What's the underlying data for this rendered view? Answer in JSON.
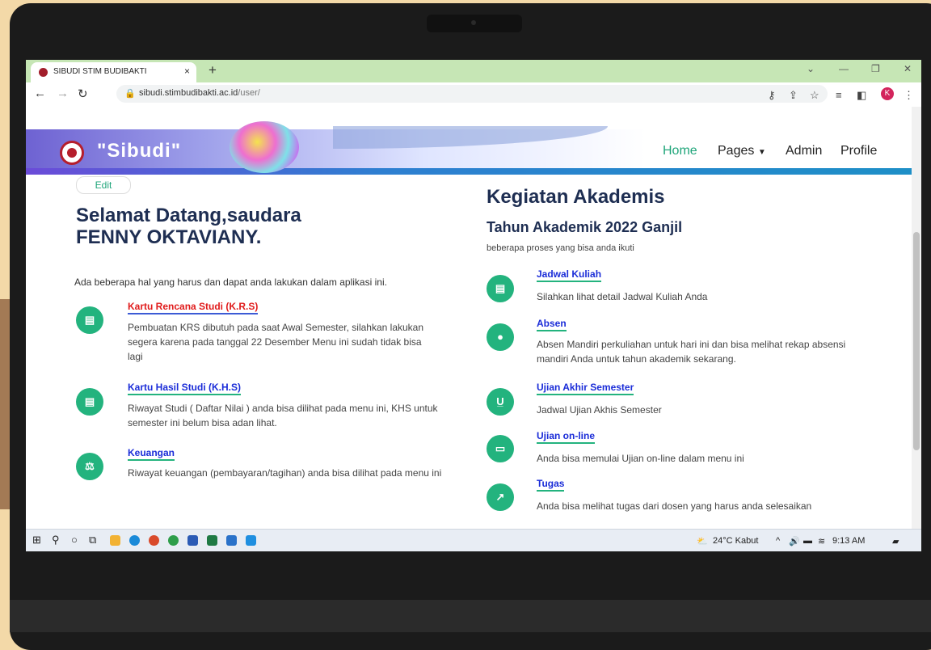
{
  "browser": {
    "tab_title": "SIBUDI STIM BUDIBAKTI",
    "tab_close": "×",
    "new_tab": "+",
    "url_host": "sibudi.stimbudibakti.ac.id",
    "url_path": "/user/",
    "profile_initial": "K"
  },
  "site": {
    "brand": "\"Sibudi\"",
    "nav": [
      "Home",
      "Pages",
      "Admin",
      "Profile"
    ],
    "edit_label": "Edit"
  },
  "welcome": {
    "line1": "Selamat Datang,saudara",
    "line2": "FENNY OKTAVIANY.",
    "intro": "Ada beberapa hal yang harus dan dapat anda lakukan dalam aplikasi ini."
  },
  "left_items": [
    {
      "title": "Kartu Rencana Studi (K.R.S)",
      "desc": "Pembuatan KRS dibutuh pada saat Awal Semester, silahkan lakukan segera karena pada tanggal 22 Desember Menu ini sudah tidak bisa lagi",
      "icon": "document-icon"
    },
    {
      "title": "Kartu Hasil Studi (K.H.S)",
      "desc": "Riwayat Studi ( Daftar Nilai ) anda bisa dilihat pada menu ini, KHS untuk semester ini belum bisa adan lihat.",
      "icon": "document-icon"
    },
    {
      "title": "Keuangan",
      "desc": "Riwayat keuangan (pembayaran/tagihan) anda bisa dilihat pada menu ini",
      "icon": "scale-icon"
    }
  ],
  "kegiatan": {
    "title": "Kegiatan Akademis",
    "subtitle": "Tahun Akademik 2022 Ganjil",
    "note": "beberapa proses yang bisa anda ikuti"
  },
  "right_items": [
    {
      "title": "Jadwal Kuliah",
      "desc": "Silahkan lihat detail Jadwal Kuliah Anda",
      "icon": "document-icon"
    },
    {
      "title": "Absen",
      "desc": "Absen Mandiri perkuliahan untuk hari ini dan bisa melihat rekap absensi mandiri Anda untuk tahun akademik sekarang.",
      "icon": "user-icon"
    },
    {
      "title": "Ujian Akhir Semester",
      "desc": "Jadwal Ujian Akhis Semester",
      "icon": "underline-icon"
    },
    {
      "title": "Ujian on-line",
      "desc": "Anda bisa memulai Ujian on-line dalam menu ini",
      "icon": "id-card-icon"
    },
    {
      "title": "Tugas",
      "desc": "Anda bisa melihat tugas dari dosen yang harus anda selesaikan",
      "icon": "chart-icon"
    }
  ],
  "taskbar": {
    "weather": "24°C Kabut",
    "time": "9:13 AM"
  },
  "colors": {
    "accent_green": "#23b37e",
    "title_blue": "#1a2cd8",
    "heading_navy": "#1e2e52",
    "krs_red": "#e01b1b"
  }
}
